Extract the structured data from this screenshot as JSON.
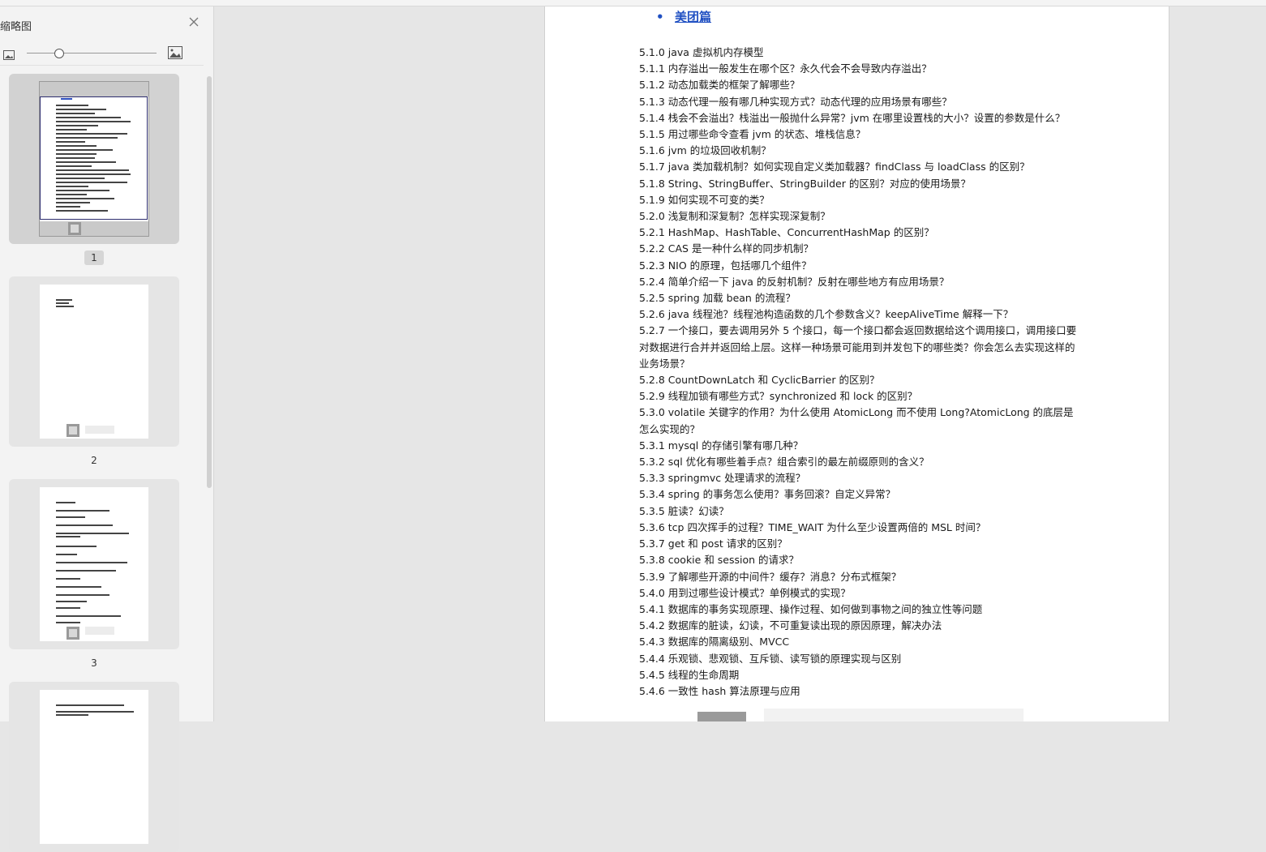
{
  "sidebar": {
    "title": "缩略图",
    "zoom": 0.25,
    "thumbnails": [
      {
        "label": "1",
        "selected": true
      },
      {
        "label": "2",
        "selected": false
      },
      {
        "label": "3",
        "selected": false
      },
      {
        "label": "",
        "selected": false
      }
    ]
  },
  "document": {
    "heading": "美团篇",
    "questions": [
      "5.1.0 java 虚拟机内存模型",
      "5.1.1  内存溢出一般发生在哪个区？永久代会不会导致内存溢出？",
      "5.1.2  动态加载类的框架了解哪些？",
      "5.1.3  动态代理一般有哪几种实现方式？动态代理的应用场景有哪些？",
      "5.1.4  栈会不会溢出？栈溢出一般抛什么异常？jvm  在哪里设置栈的大小？设置的参数是什么？",
      "5.1.5  用过哪些命令查看 jvm 的状态、堆栈信息？",
      "5.1.6 jvm 的垃圾回收机制？",
      "5.1.7 java 类加载机制？如何实现自定义类加载器？findClass 与 loadClass 的区别？",
      "5.1.8 String、StringBuffer、StringBuilder 的区别？对应的使用场景？",
      "5.1.9  如何实现不可变的类？",
      "5.2.0  浅复制和深复制？怎样实现深复制？",
      "5.2.1 HashMap、HashTable、ConcurrentHashMap 的区别？",
      "5.2.2 CAS 是一种什么样的同步机制？",
      "5.2.3 NIO 的原理，包括哪几个组件？",
      "5.2.4  简单介绍一下 java 的反射机制？反射在哪些地方有应用场景？",
      "5.2.5 spring 加载 bean 的流程？",
      "5.2.6 java 线程池？线程池构造函数的几个参数含义？keepAliveTime 解释一下？",
      "5.2.7  一个接口，要去调用另外 5 个接口，每一个接口都会返回数据给这个调用接口，调用接口要对数据进行合并并返回给上层。这样一种场景可能用到并发包下的哪些类？你会怎么去实现这样的业务场景？",
      "5.2.8 CountDownLatch 和 CyclicBarrier 的区别？",
      "5.2.9  线程加锁有哪些方式？synchronized 和 lock 的区别？",
      "5.3.0 volatile 关键字的作用？为什么使用 AtomicLong 而不使用 Long?AtomicLong 的底层是怎么实现的？",
      "5.3.1 mysql 的存储引擎有哪几种？",
      "5.3.2 sql 优化有哪些着手点？组合索引的最左前缀原则的含义？",
      "5.3.3 springmvc 处理请求的流程？",
      "5.3.4 spring 的事务怎么使用？事务回滚？自定义异常？",
      "5.3.5  脏读？幻读？",
      "5.3.6 tcp 四次挥手的过程？TIME_WAIT 为什么至少设置两倍的 MSL 时间？",
      "5.3.7 get 和 post 请求的区别？",
      "5.3.8 cookie 和 session 的请求？",
      "5.3.9  了解哪些开源的中间件？缓存？消息？分布式框架？",
      "5.4.0  用到过哪些设计模式？单例模式的实现？",
      "5.4.1  数据库的事务实现原理、操作过程、如何做到事物之间的独立性等问题",
      "5.4.2  数据库的脏读，幻读，不可重复读出现的原因原理，解决办法",
      "5.4.3  数据库的隔离级别、MVCC",
      "5.4.4  乐观锁、悲观锁、互斥锁、读写锁的原理实现与区别",
      "5.4.5  线程的生命周期",
      "5.4.6  一致性 hash 算法原理与应用"
    ]
  },
  "icons": {
    "close": "close-icon",
    "zoom_out": "image-small-icon",
    "zoom_in": "image-large-icon"
  },
  "colors": {
    "heading": "#1f4fc2",
    "selected_thumb": "#d2d2d2"
  }
}
